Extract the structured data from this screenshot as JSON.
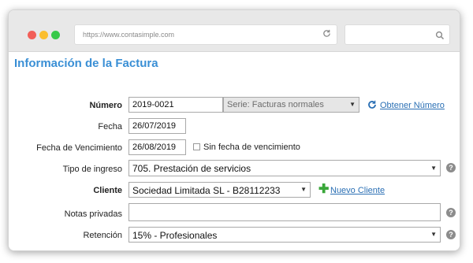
{
  "browser": {
    "url": "https://www.contasimple.com",
    "search_placeholder": ""
  },
  "page": {
    "title": "Información de la Factura"
  },
  "form": {
    "numero": {
      "label": "Número",
      "value": "2019-0021",
      "serie": "Serie: Facturas normales",
      "obtener_link": "Obtener Número"
    },
    "fecha": {
      "label": "Fecha",
      "value": "26/07/2019"
    },
    "vencimiento": {
      "label": "Fecha de Vencimiento",
      "value": "26/08/2019",
      "checkbox_label": "Sin fecha de vencimiento",
      "checked": false
    },
    "tipo_ingreso": {
      "label": "Tipo de ingreso",
      "value": "705. Prestación de servicios"
    },
    "cliente": {
      "label": "Cliente",
      "value": "Sociedad Limitada SL - B28112233",
      "nuevo_link": "Nuevo Cliente"
    },
    "notas": {
      "label": "Notas privadas",
      "value": ""
    },
    "retencion": {
      "label": "Retención",
      "value": "15% - Profesionales"
    }
  },
  "icons": {
    "reload": "reload-icon",
    "search": "search-icon",
    "refresh": "refresh-icon",
    "add": "plus-icon",
    "help": "help-icon",
    "dropdown": "chevron-down-icon"
  },
  "colors": {
    "title": "#3a8fd5",
    "link": "#2a6fb4",
    "add": "#3aa73a",
    "close_dot": "#f25f58",
    "minimize_dot": "#fbbe2e",
    "zoom_dot": "#38c94a"
  }
}
